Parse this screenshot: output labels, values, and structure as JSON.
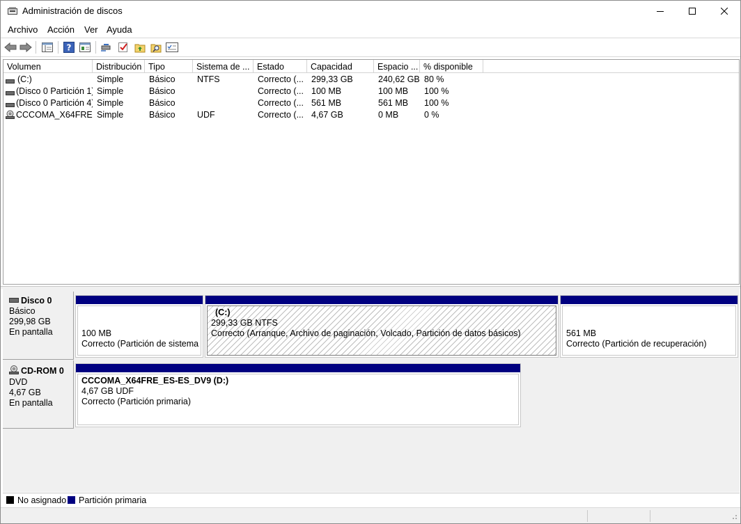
{
  "window": {
    "title": "Administración de discos"
  },
  "menu": [
    "Archivo",
    "Acción",
    "Ver",
    "Ayuda"
  ],
  "toolbar_icons": [
    "back-icon",
    "forward-icon",
    "console-tree-icon",
    "help-icon",
    "properties-pane-icon",
    "connect-disk-icon",
    "check-icon",
    "folder-up-icon",
    "folder-search-icon",
    "properties-icon"
  ],
  "columns": [
    "Volumen",
    "Distribución",
    "Tipo",
    "Sistema de ...",
    "Estado",
    "Capacidad",
    "Espacio ...",
    "% disponible"
  ],
  "volumes": [
    {
      "name": "(C:)",
      "icon": "drive-icon",
      "layout": "Simple",
      "type": "Básico",
      "fs": "NTFS",
      "status": "Correcto (...",
      "capacity": "299,33 GB",
      "free": "240,62 GB",
      "pct": "80 %"
    },
    {
      "name": "(Disco 0 Partición 1)",
      "icon": "drive-icon",
      "layout": "Simple",
      "type": "Básico",
      "fs": "",
      "status": "Correcto (...",
      "capacity": "100 MB",
      "free": "100 MB",
      "pct": "100 %"
    },
    {
      "name": "(Disco 0 Partición 4)",
      "icon": "drive-icon",
      "layout": "Simple",
      "type": "Básico",
      "fs": "",
      "status": "Correcto (...",
      "capacity": "561 MB",
      "free": "561 MB",
      "pct": "100 %"
    },
    {
      "name": "CCCOMA_X64FRE...",
      "icon": "cdrom-icon",
      "layout": "Simple",
      "type": "Básico",
      "fs": "UDF",
      "status": "Correcto (...",
      "capacity": "4,67 GB",
      "free": "0 MB",
      "pct": "0 %"
    }
  ],
  "disks": [
    {
      "name": "Disco 0",
      "kind": "Básico",
      "size": "299,98 GB",
      "state": "En pantalla",
      "partitions": [
        {
          "title": "",
          "size": "100 MB",
          "status": "Correcto (Partición de sistema EFI)"
        },
        {
          "title": "(C:)",
          "size": "299,33 GB NTFS",
          "status": "Correcto (Arranque, Archivo de paginación, Volcado, Partición de datos básicos)"
        },
        {
          "title": "",
          "size": "561 MB",
          "status": "Correcto (Partición de recuperación)"
        }
      ]
    },
    {
      "name": "CD-ROM 0",
      "kind": "DVD",
      "size": "4,67 GB",
      "state": "En pantalla",
      "partitions": [
        {
          "title": "CCCOMA_X64FRE_ES-ES_DV9  (D:)",
          "size": "4,67 GB UDF",
          "status": "Correcto (Partición primaria)"
        }
      ]
    }
  ],
  "legend": [
    {
      "label": "No asignado",
      "color": "#000000"
    },
    {
      "label": "Partición primaria",
      "color": "#000080"
    }
  ]
}
